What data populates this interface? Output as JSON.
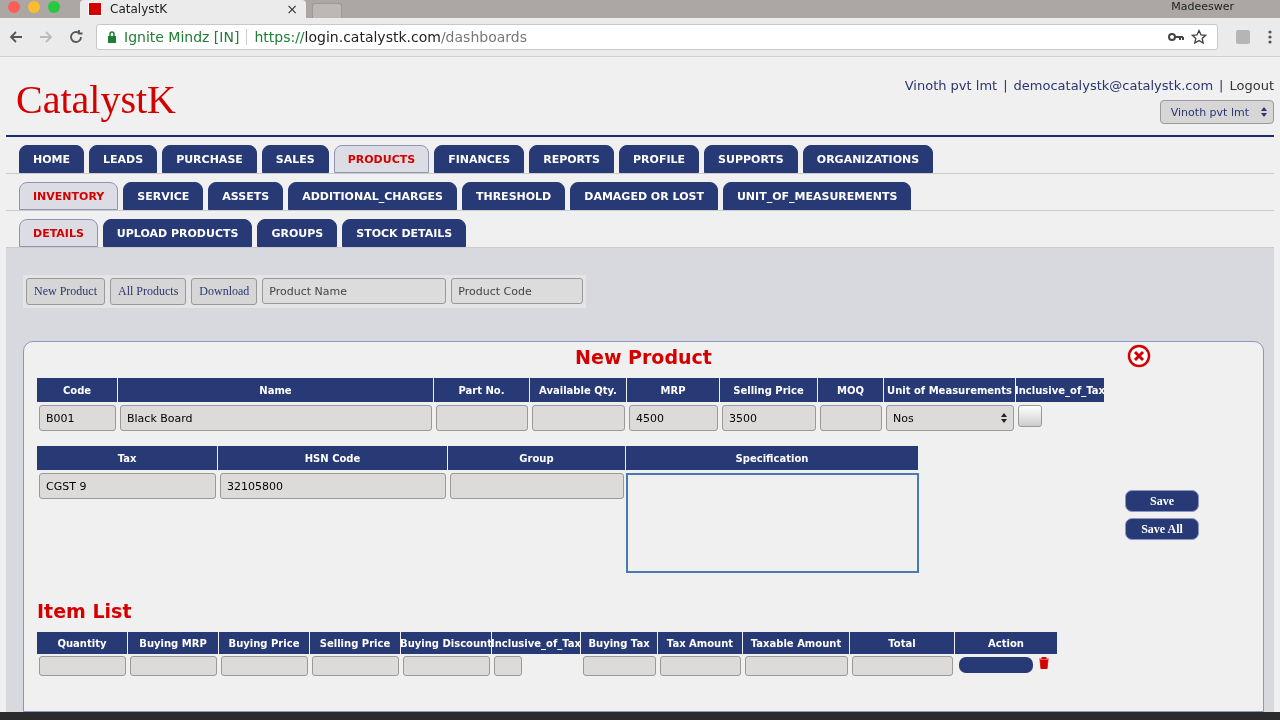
{
  "browser": {
    "tab_title": "CatalystK",
    "tab_close": "×",
    "user": "Madeeswer",
    "identity": "Ignite Mindz [IN]",
    "url_scheme": "https://",
    "url_host": "login.catalystk.com",
    "url_path": "/dashboards"
  },
  "header": {
    "logo": "CatalystK",
    "org": "Vinoth pvt lmt",
    "separator_1": "|",
    "email": "democatalystk@catalystk.com",
    "separator_2": "|",
    "logout": "Logout",
    "org_select": "Vinoth pvt lmt"
  },
  "main_tabs": [
    {
      "label": "HOME",
      "selected": false
    },
    {
      "label": "LEADS",
      "selected": false
    },
    {
      "label": "PURCHASE",
      "selected": false
    },
    {
      "label": "SALES",
      "selected": false
    },
    {
      "label": "PRODUCTS",
      "selected": true
    },
    {
      "label": "FINANCES",
      "selected": false
    },
    {
      "label": "REPORTS",
      "selected": false
    },
    {
      "label": "PROFILE",
      "selected": false
    },
    {
      "label": "SUPPORTS",
      "selected": false
    },
    {
      "label": "ORGANIZATIONS",
      "selected": false
    }
  ],
  "sub_tabs": [
    {
      "label": "INVENTORY",
      "selected": true
    },
    {
      "label": "SERVICE",
      "selected": false
    },
    {
      "label": "ASSETS",
      "selected": false
    },
    {
      "label": "ADDITIONAL_CHARGES",
      "selected": false
    },
    {
      "label": "THRESHOLD",
      "selected": false
    },
    {
      "label": "DAMAGED OR LOST",
      "selected": false
    },
    {
      "label": "UNIT_OF_MEASUREMENTS",
      "selected": false
    }
  ],
  "detail_tabs": [
    {
      "label": "DETAILS",
      "selected": true
    },
    {
      "label": "UPLOAD PRODUCTS",
      "selected": false
    },
    {
      "label": "GROUPS",
      "selected": false
    },
    {
      "label": "STOCK DETAILS",
      "selected": false
    }
  ],
  "toolbar": {
    "buttons": [
      "New Product",
      "All Products",
      "Download"
    ],
    "search_fields": [
      {
        "placeholder": "Product Name"
      },
      {
        "placeholder": "Product Code"
      }
    ]
  },
  "new_product": {
    "title": "New Product",
    "row_1": [
      {
        "label": "Code",
        "kind": "text",
        "value": "B001"
      },
      {
        "label": "Name",
        "kind": "text",
        "value": "Black Board"
      },
      {
        "label": "Part No.",
        "kind": "text"
      },
      {
        "label": "Available Qty.",
        "kind": "text"
      },
      {
        "label": "MRP",
        "kind": "text",
        "value": "4500"
      },
      {
        "label": "Selling Price",
        "kind": "text",
        "value": "3500"
      },
      {
        "label": "MOQ",
        "kind": "text"
      },
      {
        "label": "Unit of Measurements",
        "kind": "select",
        "value": "Nos"
      },
      {
        "label": "Inclusive_of_Tax",
        "kind": "checkbox",
        "checked": false
      }
    ],
    "row_2": [
      {
        "label": "Tax",
        "kind": "text",
        "value": "CGST 9"
      },
      {
        "label": "HSN Code",
        "kind": "text",
        "value": "32105800"
      },
      {
        "label": "Group",
        "kind": "text"
      },
      {
        "label": "Specification",
        "kind": "textarea",
        "focused": true
      }
    ],
    "buttons": [
      "Save",
      "Save All"
    ]
  },
  "item_list": {
    "title": "Item List",
    "columns": [
      "Quantity",
      "Buying MRP",
      "Buying Price",
      "Selling Price",
      "Buying Discount",
      "Inclusive_of_Tax",
      "Buying Tax",
      "Tax Amount",
      "Taxable Amount",
      "Total",
      "Action"
    ]
  }
}
